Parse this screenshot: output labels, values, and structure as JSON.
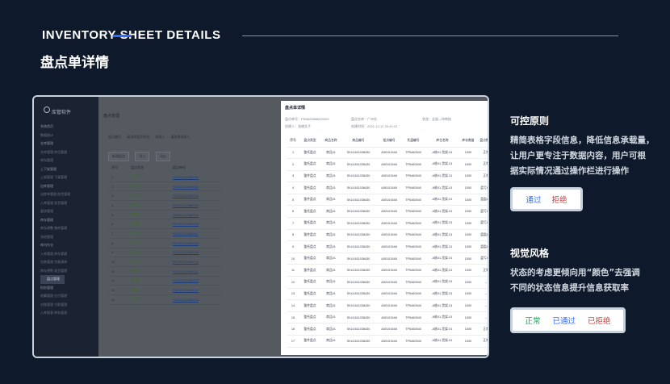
{
  "header": {
    "title": "INVENTORY SHEET DETAILS",
    "subtitle": "盘点单详情"
  },
  "app": {
    "logo": "库管软件",
    "sidebar": [
      {
        "label": "系统首页",
        "type": "group"
      },
      {
        "label": "数据统计",
        "type": "item"
      },
      {
        "label": "仓库管理",
        "type": "group"
      },
      {
        "label": "仓库管理    库位管理",
        "type": "item"
      },
      {
        "label": "库存管理",
        "type": "item"
      },
      {
        "label": "上下架管理",
        "type": "group"
      },
      {
        "label": "上架管理    下架管理",
        "type": "item"
      },
      {
        "label": "出库管理",
        "type": "group"
      },
      {
        "label": "出库单管理    拣货管理",
        "type": "item"
      },
      {
        "label": "入库管理    发货管理",
        "type": "item"
      },
      {
        "label": "复核管理",
        "type": "item"
      },
      {
        "label": "库存管理",
        "type": "group"
      },
      {
        "label": "库存调整    移库管理",
        "type": "item"
      },
      {
        "label": "冻结管理",
        "type": "item"
      },
      {
        "label": "库内作业",
        "type": "group"
      },
      {
        "label": "入库管理    库存管理",
        "type": "item"
      },
      {
        "label": "包装管理    包装清单",
        "type": "item"
      },
      {
        "label": "库存预警    收货管理",
        "type": "item"
      },
      {
        "label": "盘点管理",
        "type": "active"
      },
      {
        "label": "财务管理",
        "type": "group"
      },
      {
        "label": "结算管理    应付管理",
        "type": "item"
      },
      {
        "label": "对账管理    付款管理",
        "type": "item"
      },
      {
        "label": "入库报表    库存报表",
        "type": "item"
      }
    ],
    "main_title": "盘点管理",
    "filters": [
      "盘点编号",
      "请选择盘点状态",
      "创建人",
      "请选择创建人"
    ],
    "buttons": [
      "新建盘点",
      "导入",
      "导出"
    ],
    "bg_head": [
      "序号",
      "盘点状态",
      "盘点单号"
    ],
    "bg_rows": [
      {
        "n": "1",
        "s": "待审核",
        "code": "PD202112080001"
      },
      {
        "n": "2",
        "s": "待审核",
        "code": "PD202112080002"
      },
      {
        "n": "3",
        "s": "已完成",
        "code": "PD202112080003"
      },
      {
        "n": "4",
        "s": "待审核",
        "code": "PD202112080004"
      },
      {
        "n": "5",
        "s": "待审核",
        "code": "PD202112080005"
      },
      {
        "n": "6",
        "s": "待审核",
        "code": "PD202112080006"
      },
      {
        "n": "7",
        "s": "待审核",
        "code": "PD202112080007"
      },
      {
        "n": "8",
        "s": "待审核",
        "code": "PD202112080008"
      },
      {
        "n": "9",
        "s": "待审核",
        "code": "PD202112080009"
      },
      {
        "n": "10",
        "s": "待审核",
        "code": "PD202112080010"
      },
      {
        "n": "11",
        "s": "待审核",
        "code": "PD202112080011"
      },
      {
        "n": "12",
        "s": "待审核",
        "code": "PD202112080012"
      },
      {
        "n": "13",
        "s": "待审核",
        "code": "PD202112080013"
      },
      {
        "n": "14",
        "s": "待审核",
        "code": "PD202112080014"
      }
    ]
  },
  "modal": {
    "title": "盘点单详情",
    "meta_line1": [
      "盘点单号：PD8625888000009",
      "盘点仓库：广州仓",
      "状态：全部—待审核"
    ],
    "meta_line2": [
      "创建人：张晓文子",
      "创建时间：2021-12-12 20:20:12"
    ],
    "columns": [
      "序号",
      "盘点类型",
      "商品名称",
      "商品编号",
      "批次编号",
      "托盘编号",
      "库位名称",
      "库存数量",
      "盘点数量",
      "状态",
      "操作"
    ],
    "rows": [
      {
        "n": "1",
        "type": "整托盘点",
        "name": "商品01",
        "sku": "SKU1611038430",
        "batch": "A50101548",
        "tray": "TP5460540",
        "loc": "A栋01-货架-01",
        "stock": "1000",
        "count": "正常",
        "status": "正常",
        "status_cls": "st-green",
        "ops": [
          "--"
        ]
      },
      {
        "n": "2",
        "type": "整托盘点",
        "name": "商品01",
        "sku": "SKU1611038430",
        "batch": "A50101548",
        "tray": "TP5460540",
        "loc": "A栋01-货架-01",
        "stock": "1000",
        "count": "正常",
        "status": "正常",
        "status_cls": "st-green",
        "ops": [
          "--"
        ]
      },
      {
        "n": "3",
        "type": "整件盘点",
        "name": "商品01",
        "sku": "SKU1611038430",
        "batch": "A50101548",
        "tray": "TP5460540",
        "loc": "A栋01-货架-01",
        "stock": "1000",
        "count": "正常",
        "status": "正常",
        "status_cls": "st-green",
        "ops": [
          "--"
        ]
      },
      {
        "n": "4",
        "type": "整托盘点",
        "name": "商品01",
        "sku": "SKU1611038430",
        "batch": "A50101548",
        "tray": "TP5460540",
        "loc": "A栋01-货架-01",
        "stock": "1000",
        "count": "盘亏6件",
        "status": "已拒绝",
        "status_cls": "st-red",
        "ops": [
          "--"
        ]
      },
      {
        "n": "5",
        "type": "整件盘点",
        "name": "商品01",
        "sku": "SKU1611038430",
        "batch": "A50101548",
        "tray": "TP5460540",
        "loc": "A栋01-货架-01",
        "stock": "1000",
        "count": "盘盈8件",
        "status": "已拒绝",
        "status_cls": "st-red",
        "ops": [
          "--"
        ]
      },
      {
        "n": "6",
        "type": "整托盘点",
        "name": "商品01",
        "sku": "SKU1611038430",
        "batch": "A50101548",
        "tray": "TP5460540",
        "loc": "A栋01-货架-01",
        "stock": "1000",
        "count": "盘亏6件",
        "status": "已拒绝",
        "status_cls": "st-red",
        "ops": [
          "--"
        ]
      },
      {
        "n": "7",
        "type": "整托盘点",
        "name": "商品01",
        "sku": "SKU1611038430",
        "batch": "A50101548",
        "tray": "TP5460540",
        "loc": "A栋01-货架-01",
        "stock": "1000",
        "count": "盘亏6件",
        "status": "已通过",
        "status_cls": "st-blue",
        "ops": [
          "--"
        ]
      },
      {
        "n": "8",
        "type": "整件盘点",
        "name": "商品01",
        "sku": "SKU1611038430",
        "batch": "A50101548",
        "tray": "TP5460540",
        "loc": "A栋01-货架-01",
        "stock": "1000",
        "count": "盘盈8件",
        "status": "已通过",
        "status_cls": "st-blue",
        "ops": [
          "--"
        ]
      },
      {
        "n": "9",
        "type": "整托盘点",
        "name": "商品01",
        "sku": "SKU1611038430",
        "batch": "A50101548",
        "tray": "TP5460540",
        "loc": "A栋01-货架-01",
        "stock": "1000",
        "count": "盘盈8件",
        "status": "已通过",
        "status_cls": "st-blue",
        "ops": [
          "--"
        ]
      },
      {
        "n": "10",
        "type": "整托盘点",
        "name": "商品01",
        "sku": "SKU1611038430",
        "batch": "A50101548",
        "tray": "TP5460540",
        "loc": "A栋01-货架-01",
        "stock": "1000",
        "count": "盘亏6件",
        "status": "已通过",
        "status_cls": "st-blue",
        "ops": [
          "--"
        ]
      },
      {
        "n": "11",
        "type": "整件盘点",
        "name": "商品01",
        "sku": "SKU1611038430",
        "batch": "A50101548",
        "tray": "TP5460540",
        "loc": "A栋01-货架-01",
        "stock": "1000",
        "count": "正常",
        "status": "正常",
        "status_cls": "st-green",
        "ops": [
          "--"
        ]
      },
      {
        "n": "12",
        "type": "整托盘点",
        "name": "商品01",
        "sku": "SKU1611038430",
        "batch": "A50101548",
        "tray": "TP5460540",
        "loc": "A栋01-货架-01",
        "stock": "1000",
        "count": "--",
        "status": "--",
        "status_cls": "",
        "ops": [
          "通过",
          "拒绝"
        ]
      },
      {
        "n": "13",
        "type": "整托盘点",
        "name": "商品01",
        "sku": "SKU1611038430",
        "batch": "A50101548",
        "tray": "TP5460540",
        "loc": "A栋01-货架-01",
        "stock": "1000",
        "count": "--",
        "status": "--",
        "status_cls": "",
        "ops": [
          "通过",
          "拒绝"
        ]
      },
      {
        "n": "14",
        "type": "整件盘点",
        "name": "商品01",
        "sku": "SKU1611038430",
        "batch": "A50101548",
        "tray": "TP5460540",
        "loc": "A栋01-货架-01",
        "stock": "1000",
        "count": "--",
        "status": "--",
        "status_cls": "",
        "ops": [
          "通过",
          "拒绝"
        ]
      },
      {
        "n": "15",
        "type": "整托盘点",
        "name": "商品01",
        "sku": "SKU1611038430",
        "batch": "A50101548",
        "tray": "TP5460540",
        "loc": "A栋01-货架-01",
        "stock": "1000",
        "count": "--",
        "status": "--",
        "status_cls": "",
        "ops": [
          "通过",
          "拒绝"
        ]
      },
      {
        "n": "16",
        "type": "整托盘点",
        "name": "商品01",
        "sku": "SKU1611038430",
        "batch": "A50101548",
        "tray": "TP5460540",
        "loc": "A栋01-货架-01",
        "stock": "1000",
        "count": "正常",
        "status": "正常",
        "status_cls": "st-green",
        "ops": [
          "--"
        ]
      },
      {
        "n": "17",
        "type": "整件盘点",
        "name": "商品01",
        "sku": "SKU1611038430",
        "batch": "A50101548",
        "tray": "TP5460540",
        "loc": "A栋01-货架-01",
        "stock": "1000",
        "count": "正常",
        "status": "正常",
        "status_cls": "st-green",
        "ops": [
          "--"
        ]
      }
    ]
  },
  "principles": {
    "title": "可控原则",
    "body_lines": [
      "精简表格字段信息，降低信息承载量，",
      "让用户更专注于数据内容，用户可根",
      "据实际情况通过操作栏进行操作"
    ],
    "pill_pass": "通过",
    "pill_reject": "拒绝"
  },
  "style": {
    "title": "视觉风格",
    "body_lines": [
      "状态的考虑更倾向用“颜色”去强调",
      "不同的状态信息提升信息获取率"
    ],
    "pill_normal": "正常",
    "pill_passed": "已通过",
    "pill_rejected": "已拒绝"
  },
  "colors": {
    "background": "#0e1a2b",
    "accent": "#2f6bff",
    "green": "#19a25a",
    "red": "#e23a3a"
  }
}
